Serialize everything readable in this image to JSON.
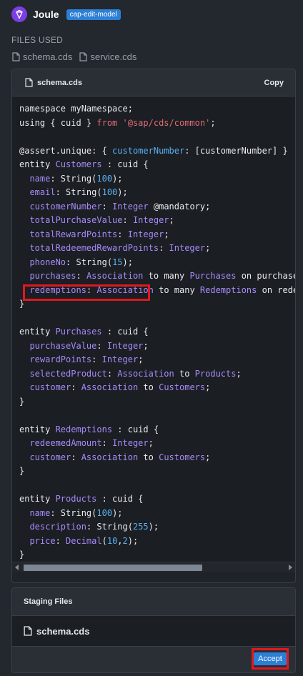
{
  "header": {
    "title": "Joule",
    "mode_badge": "cap-edit-model"
  },
  "files_used": {
    "label": "FILES USED",
    "files": [
      "schema.cds",
      "service.cds"
    ]
  },
  "code_panel": {
    "filename": "schema.cds",
    "copy_label": "Copy",
    "lines": [
      [
        {
          "t": "namespace myNamespace;",
          "c": "kw"
        }
      ],
      [
        {
          "t": "using { cuid } ",
          "c": "kw"
        },
        {
          "t": "from",
          "c": "from"
        },
        {
          "t": " '@sap/cds/common'",
          "c": "str"
        },
        {
          "t": ";",
          "c": "kw"
        }
      ],
      [
        {
          "t": "",
          "c": "kw"
        }
      ],
      [
        {
          "t": "@assert.unique: { ",
          "c": "kw"
        },
        {
          "t": "customerNumber",
          "c": "cust"
        },
        {
          "t": ": [customerNumber] }",
          "c": "kw"
        }
      ],
      [
        {
          "t": "entity ",
          "c": "kw"
        },
        {
          "t": "Customers",
          "c": "ent"
        },
        {
          "t": " : cuid {",
          "c": "kw"
        }
      ],
      [
        {
          "t": "  ",
          "c": "kw"
        },
        {
          "t": "name",
          "c": "fld"
        },
        {
          "t": ": String(",
          "c": "kw"
        },
        {
          "t": "100",
          "c": "num"
        },
        {
          "t": ");",
          "c": "kw"
        }
      ],
      [
        {
          "t": "  ",
          "c": "kw"
        },
        {
          "t": "email",
          "c": "fld"
        },
        {
          "t": ": String(",
          "c": "kw"
        },
        {
          "t": "100",
          "c": "num"
        },
        {
          "t": ");",
          "c": "kw"
        }
      ],
      [
        {
          "t": "  ",
          "c": "kw"
        },
        {
          "t": "customerNumber",
          "c": "fld"
        },
        {
          "t": ": ",
          "c": "kw"
        },
        {
          "t": "Integer",
          "c": "typ"
        },
        {
          "t": " @mandatory;",
          "c": "kw"
        }
      ],
      [
        {
          "t": "  ",
          "c": "kw"
        },
        {
          "t": "totalPurchaseValue",
          "c": "fld"
        },
        {
          "t": ": ",
          "c": "kw"
        },
        {
          "t": "Integer",
          "c": "typ"
        },
        {
          "t": ";",
          "c": "kw"
        }
      ],
      [
        {
          "t": "  ",
          "c": "kw"
        },
        {
          "t": "totalRewardPoints",
          "c": "fld"
        },
        {
          "t": ": ",
          "c": "kw"
        },
        {
          "t": "Integer",
          "c": "typ"
        },
        {
          "t": ";",
          "c": "kw"
        }
      ],
      [
        {
          "t": "  ",
          "c": "kw"
        },
        {
          "t": "totalRedeemedRewardPoints",
          "c": "fld"
        },
        {
          "t": ": ",
          "c": "kw"
        },
        {
          "t": "Integer",
          "c": "typ"
        },
        {
          "t": ";",
          "c": "kw"
        }
      ],
      [
        {
          "t": "  ",
          "c": "kw"
        },
        {
          "t": "phoneNo",
          "c": "fld"
        },
        {
          "t": ": String(",
          "c": "kw"
        },
        {
          "t": "15",
          "c": "num"
        },
        {
          "t": ");",
          "c": "kw"
        }
      ],
      [
        {
          "t": "  ",
          "c": "kw"
        },
        {
          "t": "purchases",
          "c": "fld"
        },
        {
          "t": ": ",
          "c": "kw"
        },
        {
          "t": "Association",
          "c": "typ"
        },
        {
          "t": " to many ",
          "c": "kw"
        },
        {
          "t": "Purchases",
          "c": "ent"
        },
        {
          "t": " on purchase",
          "c": "kw"
        }
      ],
      [
        {
          "t": "  ",
          "c": "kw"
        },
        {
          "t": "redemptions",
          "c": "fld"
        },
        {
          "t": ": ",
          "c": "kw"
        },
        {
          "t": "Association",
          "c": "typ"
        },
        {
          "t": " to many ",
          "c": "kw"
        },
        {
          "t": "Redemptions",
          "c": "ent"
        },
        {
          "t": " on rede",
          "c": "kw"
        }
      ],
      [
        {
          "t": "}",
          "c": "kw"
        }
      ],
      [
        {
          "t": "",
          "c": "kw"
        }
      ],
      [
        {
          "t": "entity ",
          "c": "kw"
        },
        {
          "t": "Purchases",
          "c": "ent"
        },
        {
          "t": " : cuid {",
          "c": "kw"
        }
      ],
      [
        {
          "t": "  ",
          "c": "kw"
        },
        {
          "t": "purchaseValue",
          "c": "fld"
        },
        {
          "t": ": ",
          "c": "kw"
        },
        {
          "t": "Integer",
          "c": "typ"
        },
        {
          "t": ";",
          "c": "kw"
        }
      ],
      [
        {
          "t": "  ",
          "c": "kw"
        },
        {
          "t": "rewardPoints",
          "c": "fld"
        },
        {
          "t": ": ",
          "c": "kw"
        },
        {
          "t": "Integer",
          "c": "typ"
        },
        {
          "t": ";",
          "c": "kw"
        }
      ],
      [
        {
          "t": "  ",
          "c": "kw"
        },
        {
          "t": "selectedProduct",
          "c": "fld"
        },
        {
          "t": ": ",
          "c": "kw"
        },
        {
          "t": "Association",
          "c": "typ"
        },
        {
          "t": " to ",
          "c": "kw"
        },
        {
          "t": "Products",
          "c": "ent"
        },
        {
          "t": ";",
          "c": "kw"
        }
      ],
      [
        {
          "t": "  ",
          "c": "kw"
        },
        {
          "t": "customer",
          "c": "fld"
        },
        {
          "t": ": ",
          "c": "kw"
        },
        {
          "t": "Association",
          "c": "typ"
        },
        {
          "t": " to ",
          "c": "kw"
        },
        {
          "t": "Customers",
          "c": "ent"
        },
        {
          "t": ";",
          "c": "kw"
        }
      ],
      [
        {
          "t": "}",
          "c": "kw"
        }
      ],
      [
        {
          "t": "",
          "c": "kw"
        }
      ],
      [
        {
          "t": "entity ",
          "c": "kw"
        },
        {
          "t": "Redemptions",
          "c": "ent"
        },
        {
          "t": " : cuid {",
          "c": "kw"
        }
      ],
      [
        {
          "t": "  ",
          "c": "kw"
        },
        {
          "t": "redeemedAmount",
          "c": "fld"
        },
        {
          "t": ": ",
          "c": "kw"
        },
        {
          "t": "Integer",
          "c": "typ"
        },
        {
          "t": ";",
          "c": "kw"
        }
      ],
      [
        {
          "t": "  ",
          "c": "kw"
        },
        {
          "t": "customer",
          "c": "fld"
        },
        {
          "t": ": ",
          "c": "kw"
        },
        {
          "t": "Association",
          "c": "typ"
        },
        {
          "t": " to ",
          "c": "kw"
        },
        {
          "t": "Customers",
          "c": "ent"
        },
        {
          "t": ";",
          "c": "kw"
        }
      ],
      [
        {
          "t": "}",
          "c": "kw"
        }
      ],
      [
        {
          "t": "",
          "c": "kw"
        }
      ],
      [
        {
          "t": "entity ",
          "c": "kw"
        },
        {
          "t": "Products",
          "c": "ent"
        },
        {
          "t": " : cuid {",
          "c": "kw"
        }
      ],
      [
        {
          "t": "  ",
          "c": "kw"
        },
        {
          "t": "name",
          "c": "fld"
        },
        {
          "t": ": String(",
          "c": "kw"
        },
        {
          "t": "100",
          "c": "num"
        },
        {
          "t": ");",
          "c": "kw"
        }
      ],
      [
        {
          "t": "  ",
          "c": "kw"
        },
        {
          "t": "description",
          "c": "fld"
        },
        {
          "t": ": String(",
          "c": "kw"
        },
        {
          "t": "255",
          "c": "num"
        },
        {
          "t": ");",
          "c": "kw"
        }
      ],
      [
        {
          "t": "  ",
          "c": "kw"
        },
        {
          "t": "price",
          "c": "fld"
        },
        {
          "t": ": ",
          "c": "kw"
        },
        {
          "t": "Decimal",
          "c": "typ"
        },
        {
          "t": "(",
          "c": "kw"
        },
        {
          "t": "10",
          "c": "num"
        },
        {
          "t": ",",
          "c": "kw"
        },
        {
          "t": "2",
          "c": "num"
        },
        {
          "t": ");",
          "c": "kw"
        }
      ],
      [
        {
          "t": "}",
          "c": "kw"
        }
      ]
    ]
  },
  "staging": {
    "title": "Staging Files",
    "file": "schema.cds",
    "accept_label": "Accept"
  },
  "colors": {
    "accent": "#2d7fd6",
    "highlight": "#e0181f",
    "logo": "#7b3fe4"
  },
  "icons": [
    "joule-logo-icon",
    "file-icon"
  ]
}
